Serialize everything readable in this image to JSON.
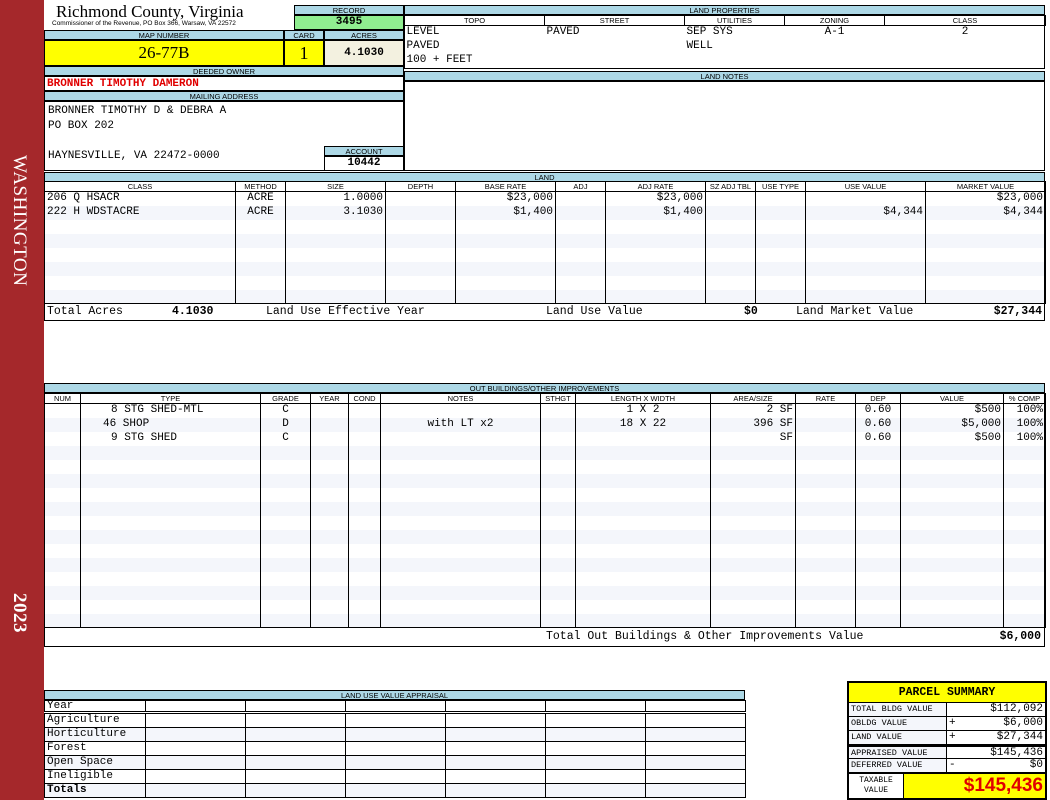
{
  "sidebar": {
    "district": "WASHINGTON",
    "year": "2023",
    "color": "#a5282b"
  },
  "header": {
    "county": "Richmond County, Virginia",
    "subtitle": "Commissioner of the Revenue, PO Box 366, Warsaw, VA 22572",
    "record_label": "RECORD",
    "record": "3495",
    "map_label": "MAP NUMBER",
    "map": "26-77B",
    "card_label": "CARD",
    "card": "1",
    "acres_label": "ACRES",
    "acres": "4.1030"
  },
  "owner": {
    "label": "DEEDED OWNER",
    "name": "BRONNER TIMOTHY DAMERON",
    "mail_label": "MAILING ADDRESS",
    "line1": "BRONNER TIMOTHY D & DEBRA A",
    "line2": "PO BOX 202",
    "line3": "HAYNESVILLE, VA 22472-0000",
    "account_label": "ACCOUNT",
    "account": "10442"
  },
  "land_properties": {
    "label": "LAND PROPERTIES",
    "columns": [
      "TOPO",
      "STREET",
      "UTILITIES",
      "ZONING",
      "CLASS"
    ],
    "rows": [
      [
        "LEVEL",
        "PAVED",
        "SEP SYS",
        "A-1",
        "2"
      ],
      [
        "PAVED",
        "",
        "WELL",
        "",
        ""
      ],
      [
        "100 + FEET",
        "",
        "",
        "",
        ""
      ]
    ]
  },
  "land_notes": {
    "label": "LAND NOTES"
  },
  "land": {
    "label": "LAND",
    "columns": [
      "CLASS",
      "METHOD",
      "SIZE",
      "DEPTH",
      "BASE RATE",
      "ADJ",
      "ADJ RATE",
      "SZ ADJ TBL",
      "USE TYPE",
      "USE VALUE",
      "MARKET VALUE"
    ],
    "rows": [
      [
        "206 Q HSACR",
        "ACRE",
        "1.0000",
        "",
        "$23,000",
        "",
        "$23,000",
        "",
        "",
        "",
        "$23,000"
      ],
      [
        "222 H WDSTACRE",
        "ACRE",
        "3.1030",
        "",
        "$1,400",
        "",
        "$1,400",
        "",
        "",
        "$4,344",
        "$4,344"
      ]
    ],
    "totals": {
      "acres_label": "Total Acres",
      "acres": "4.1030",
      "eff_year_label": "Land Use Effective Year",
      "use_value_label": "Land Use Value",
      "use_value": "$0",
      "market_label": "Land Market Value",
      "market": "$27,344"
    }
  },
  "outbuildings": {
    "label": "OUT BUILDINGS/OTHER IMPROVEMENTS",
    "columns": [
      "NUM",
      "TYPE",
      "GRADE",
      "YEAR",
      "COND",
      "NOTES",
      "STHGT",
      "LENGTH X WIDTH",
      "AREA/SIZE",
      "RATE",
      "DEP",
      "VALUE",
      "% COMP"
    ],
    "rows": [
      [
        "",
        "8 STG SHED-MTL",
        "C",
        "",
        "",
        "",
        "",
        "1 X 2",
        "2 SF",
        "",
        "0.60",
        "$500",
        "100%"
      ],
      [
        "",
        "46 SHOP",
        "D",
        "",
        "",
        "with LT x2",
        "",
        "18 X 22",
        "396 SF",
        "",
        "0.60",
        "$5,000",
        "100%"
      ],
      [
        "",
        "9 STG SHED",
        "C",
        "",
        "",
        "",
        "",
        "",
        "SF",
        "",
        "0.60",
        "$500",
        "100%"
      ]
    ],
    "total_label": "Total Out Buildings & Other Improvements Value",
    "total": "$6,000"
  },
  "land_use_appraisal": {
    "label": "LAND USE VALUE APPRAISAL",
    "year_label": "Year",
    "rows": [
      "Agriculture",
      "Horticulture",
      "Forest",
      "Open Space",
      "Ineligible"
    ],
    "totals_label": "Totals"
  },
  "parcel_summary": {
    "title": "PARCEL SUMMARY",
    "rows": [
      {
        "label": "TOTAL BLDG VALUE",
        "sign": "",
        "value": "$112,092"
      },
      {
        "label": "OBLDG VALUE",
        "sign": "+",
        "value": "$6,000"
      },
      {
        "label": "LAND VALUE",
        "sign": "+",
        "value": "$27,344"
      },
      {
        "label": "APPRAISED VALUE",
        "sign": "",
        "value": "$145,436"
      },
      {
        "label": "DEFERRED VALUE",
        "sign": "-",
        "value": "$0"
      }
    ],
    "taxable_label": "TAXABLE VALUE",
    "taxable": "$145,436"
  }
}
